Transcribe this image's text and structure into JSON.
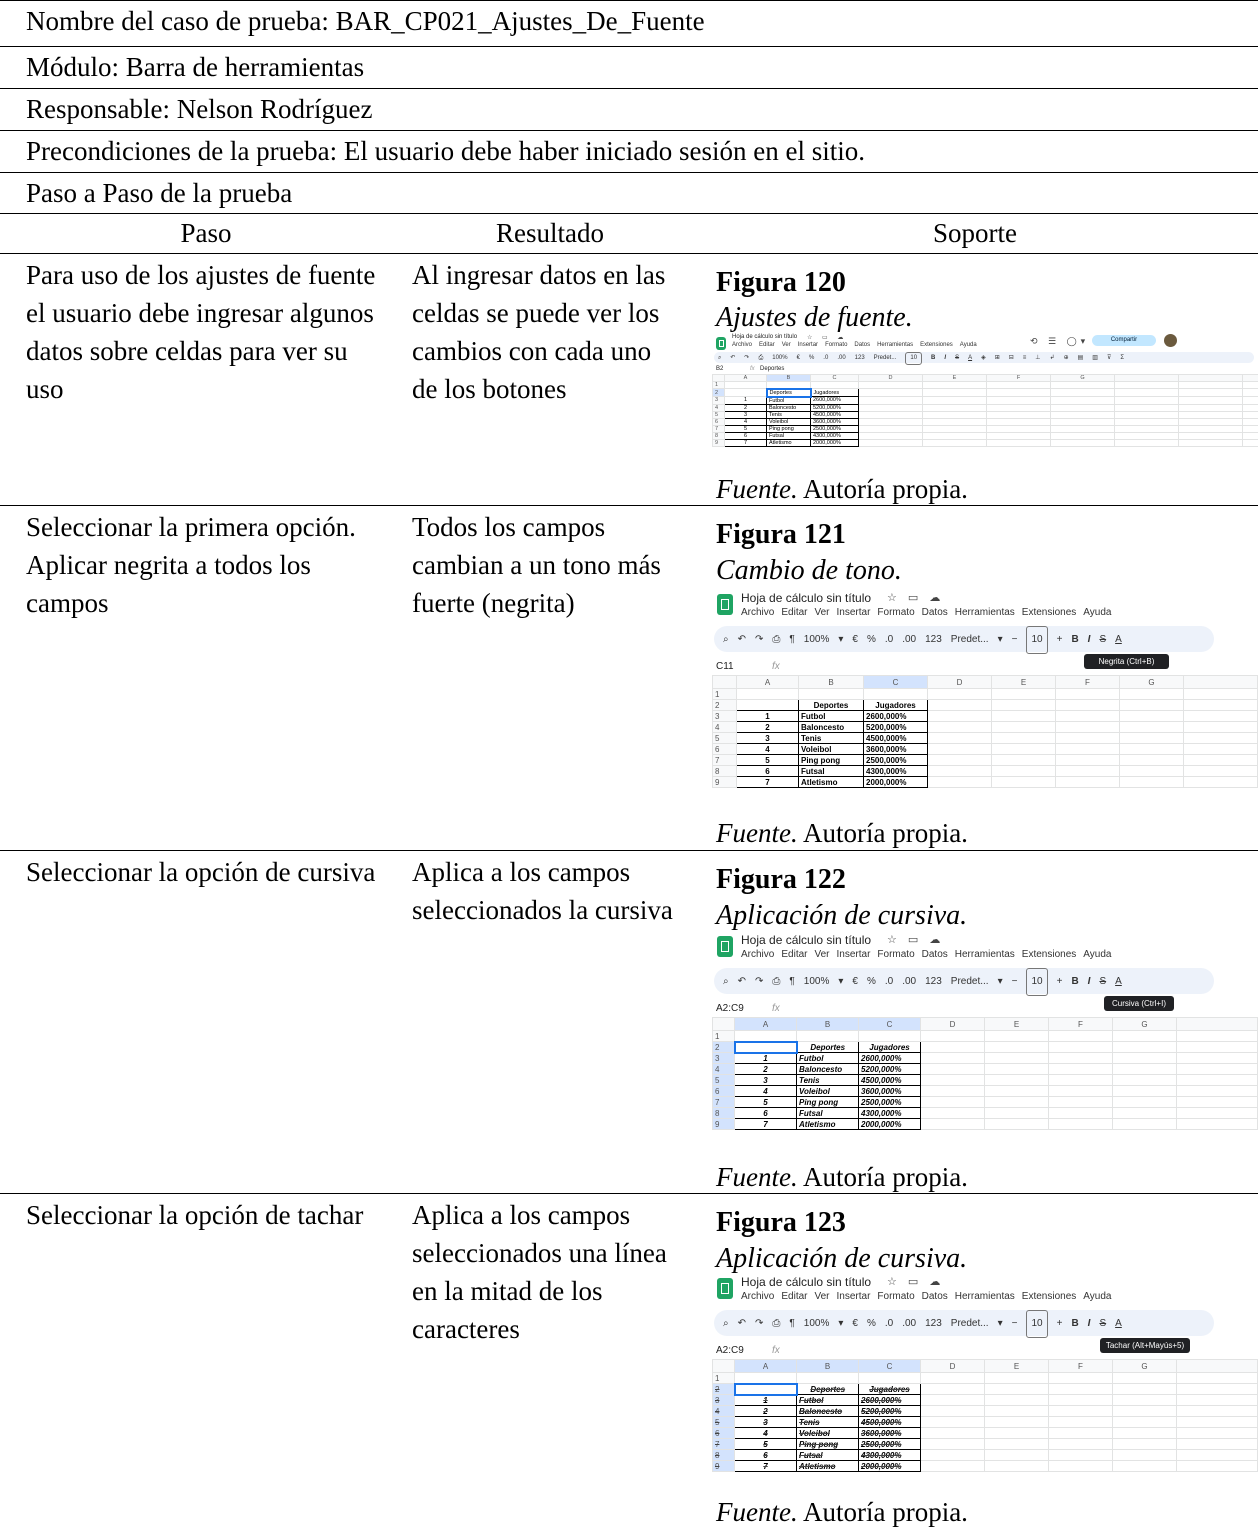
{
  "doc": {
    "case_name": "Nombre del caso de prueba: BAR_CP021_Ajustes_De_Fuente",
    "module": "Módulo: Barra de herramientas",
    "owner": "Responsable: Nelson Rodríguez",
    "preconditions": "Precondiciones de la prueba: El usuario debe haber iniciado sesión en el sitio.",
    "steps_heading": "Paso a Paso de la prueba",
    "columns": [
      "Paso",
      "Resultado",
      "Soporte"
    ]
  },
  "source_label": "Fuente.",
  "source_text": " Autoría propia.",
  "sheet": {
    "doc_title": "Hoja de cálculo sin título",
    "menu": [
      "Archivo",
      "Editar",
      "Ver",
      "Insertar",
      "Formato",
      "Datos",
      "Herramientas",
      "Extensiones",
      "Ayuda"
    ],
    "zoom": "100%",
    "currency": "€",
    "percent": "%",
    "dec_less": ".0",
    "dec_more": ".00",
    "num_fmt": "123",
    "font_short": "Predet...",
    "font_size": "10",
    "col_letters": [
      "A",
      "B",
      "C",
      "D",
      "E",
      "F",
      "G"
    ],
    "header_deportes": "Deportes",
    "header_jugadores": "Jugadores",
    "rows": [
      {
        "n": "1",
        "sport": "Futbol",
        "players": "2600,000%"
      },
      {
        "n": "2",
        "sport": "Baloncesto",
        "players": "5200,000%"
      },
      {
        "n": "3",
        "sport": "Tenis",
        "players": "4500,000%"
      },
      {
        "n": "4",
        "sport": "Voleibol",
        "players": "3600,000%"
      },
      {
        "n": "5",
        "sport": "Ping pong",
        "players": "2500,000%"
      },
      {
        "n": "6",
        "sport": "Futsal",
        "players": "4300,000%"
      },
      {
        "n": "7",
        "sport": "Atletismo",
        "players": "2000,000%"
      }
    ]
  },
  "steps": [
    {
      "paso": "Para uso de los ajustes de fuente el usuario debe ingresar algunos datos sobre celdas para ver su uso",
      "resultado": "Al ingresar datos en las celdas se puede ver los cambios con cada uno de los botones",
      "figure_num": "Figura 120",
      "figure_title": "Ajustes de fuente.",
      "name_box": "B2",
      "formula": "Deportes",
      "share_label": "Compartir"
    },
    {
      "paso": "Seleccionar la primera opción. Aplicar negrita a todos los campos",
      "resultado": "Todos los campos cambian a un tono más fuerte (negrita)",
      "figure_num": "Figura 121",
      "figure_title": "Cambio de tono.",
      "name_box": "C11",
      "tooltip": "Negrita (Ctrl+B)"
    },
    {
      "paso": "Seleccionar la opción de cursiva",
      "resultado": "Aplica a los campos seleccionados la cursiva",
      "figure_num": "Figura 122",
      "figure_title": "Aplicación de cursiva.",
      "name_box": "A2:C9",
      "tooltip": "Cursiva (Ctrl+I)"
    },
    {
      "paso": "Seleccionar la opción de tachar",
      "resultado": "Aplica a los campos seleccionados una línea en la mitad de los caracteres",
      "figure_num": "Figura 123",
      "figure_title": "Aplicación de cursiva.",
      "name_box": "A2:C9",
      "tooltip": "Tachar (Alt+Mayús+5)"
    }
  ]
}
